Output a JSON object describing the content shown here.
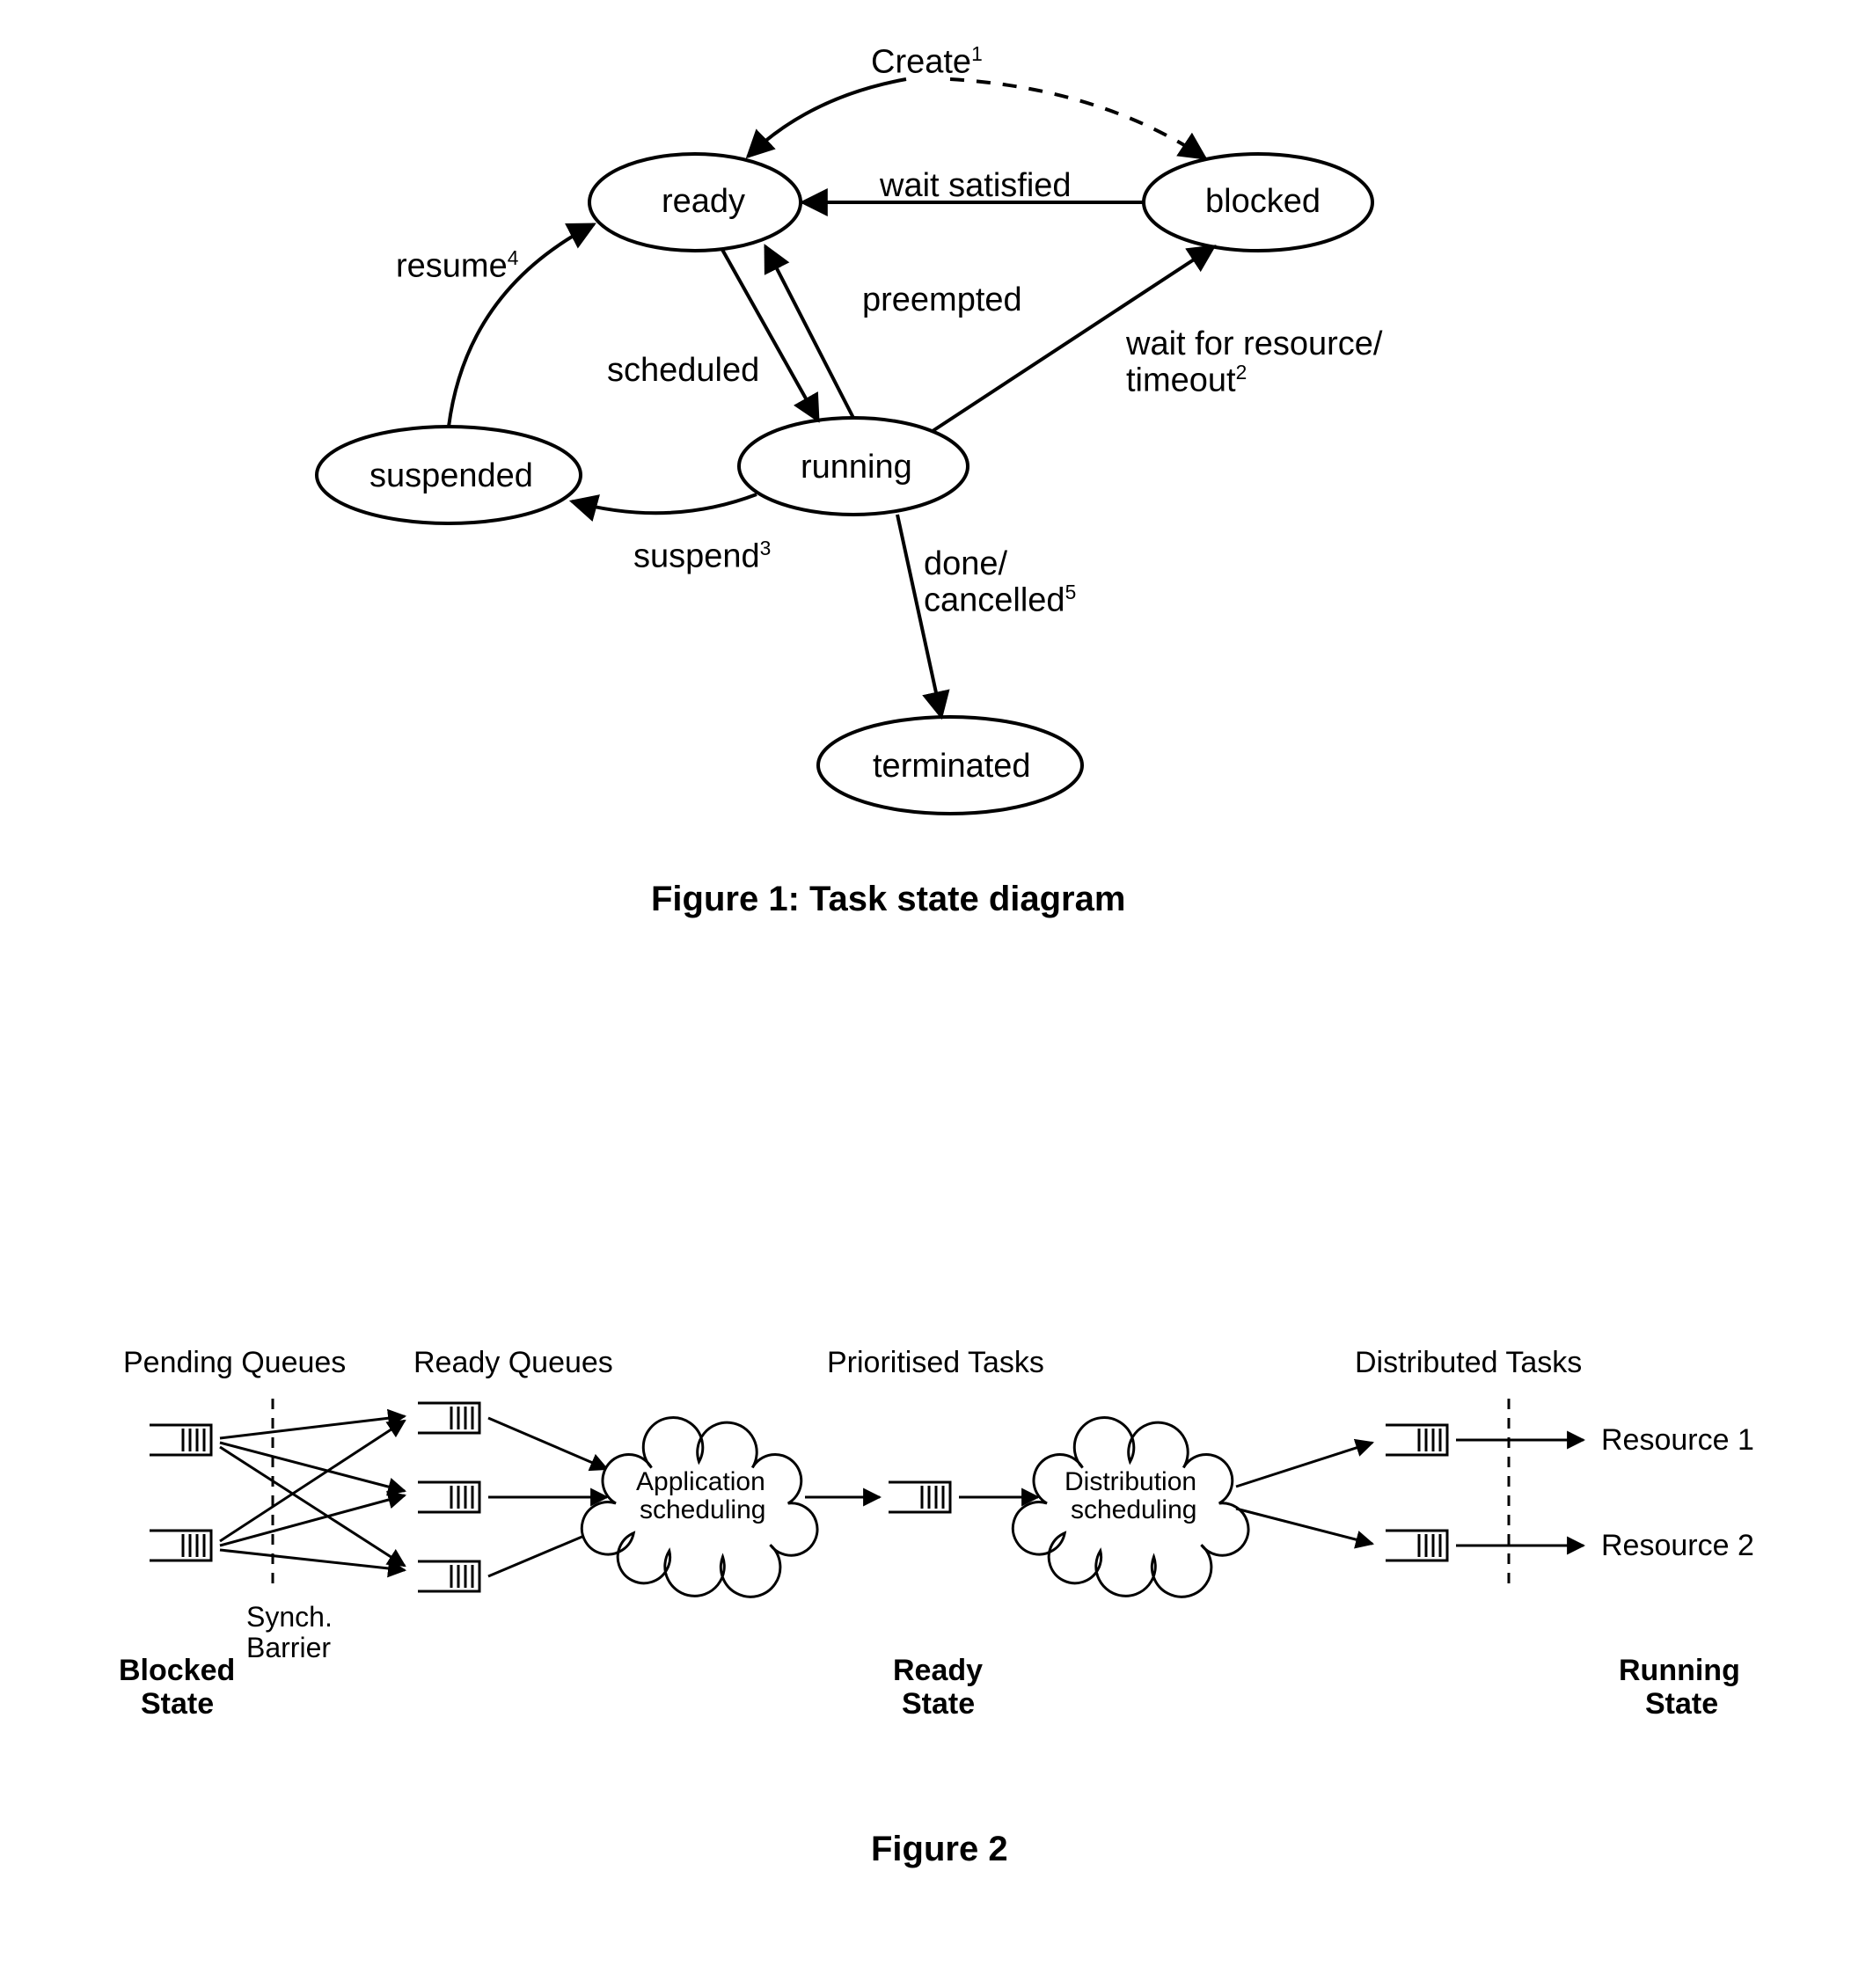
{
  "figure1": {
    "caption": "Figure 1:  Task state diagram",
    "states": {
      "ready": "ready",
      "blocked": "blocked",
      "running": "running",
      "suspended": "suspended",
      "terminated": "terminated"
    },
    "transitions": {
      "create": "Create",
      "create_sup": "1",
      "wait_satisfied": "wait satisfied",
      "preempted": "preempted",
      "scheduled": "scheduled",
      "wait_for_resource": "wait for resource/",
      "timeout": "timeout",
      "timeout_sup": "2",
      "suspend": "suspend",
      "suspend_sup": "3",
      "resume": "resume",
      "resume_sup": "4",
      "done_cancelled_line1": "done/",
      "done_cancelled_line2": "cancelled",
      "done_cancelled_sup": "5"
    }
  },
  "figure2": {
    "caption": "Figure 2",
    "headers": {
      "pending_queues": "Pending Queues",
      "ready_queues": "Ready Queues",
      "prioritised_tasks": "Prioritised Tasks",
      "distributed_tasks": "Distributed Tasks"
    },
    "labels": {
      "synch_barrier_line1": "Synch.",
      "synch_barrier_line2": "Barrier",
      "application_line1": "Application",
      "application_line2": "scheduling",
      "distribution_line1": "Distribution",
      "distribution_line2": "scheduling",
      "resource1": "Resource 1",
      "resource2": "Resource 2"
    },
    "states": {
      "blocked_line1": "Blocked",
      "blocked_line2": "State",
      "ready_line1": "Ready",
      "ready_line2": "State",
      "running_line1": "Running",
      "running_line2": "State"
    }
  }
}
